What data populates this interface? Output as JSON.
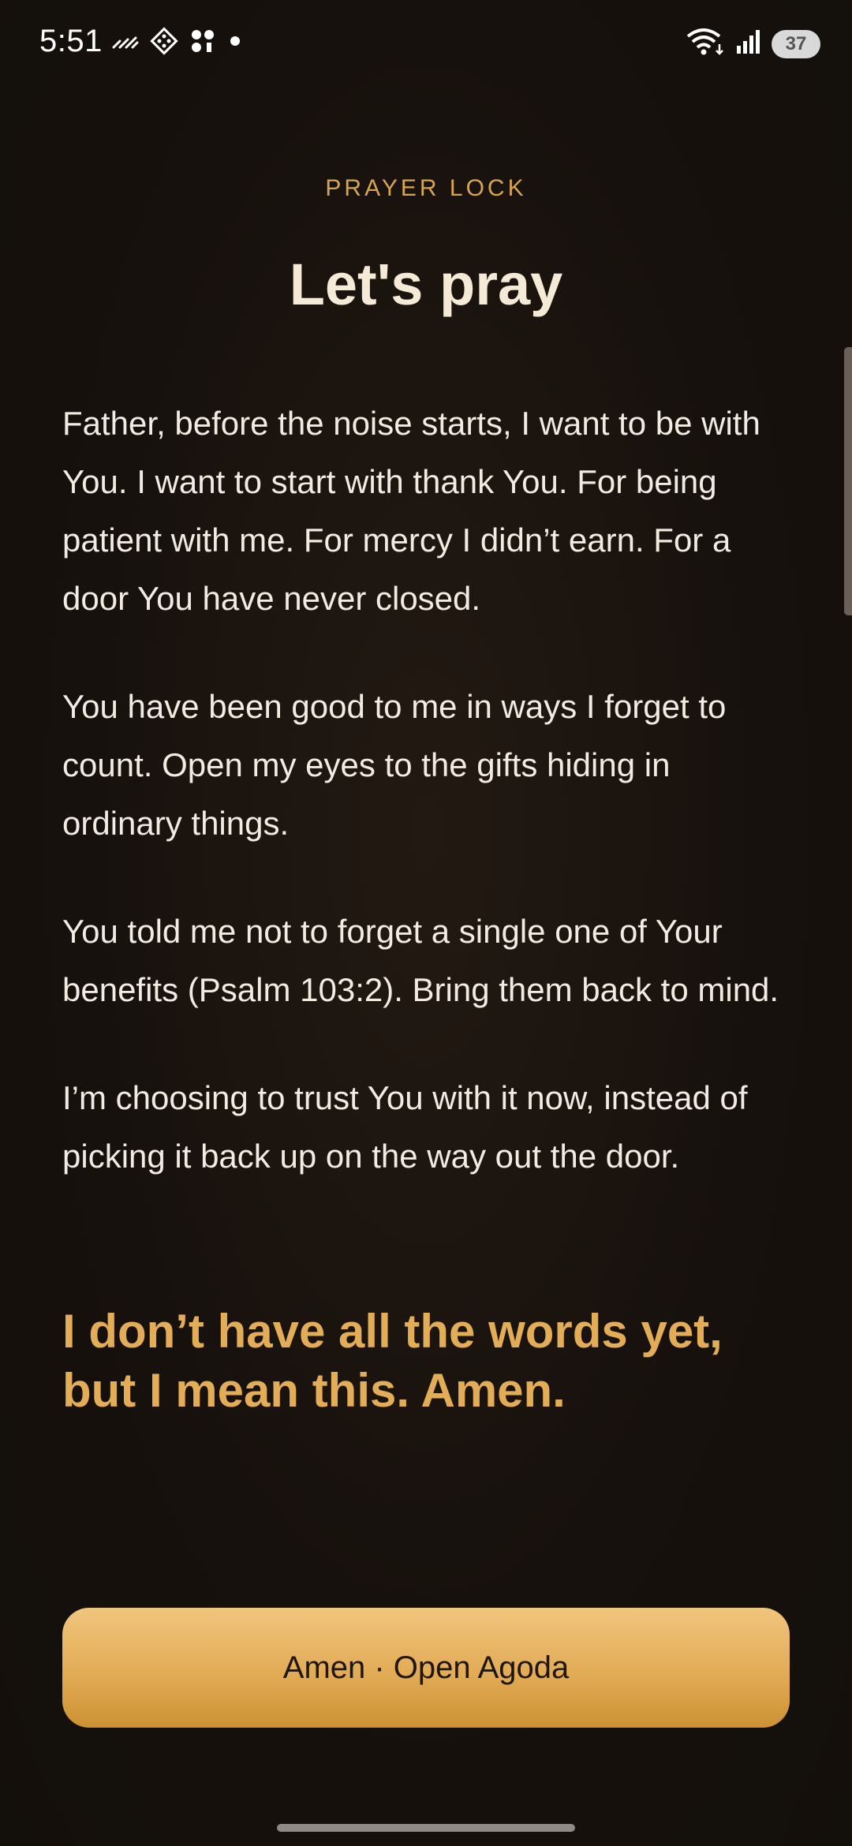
{
  "status_bar": {
    "time": "5:51",
    "battery": "37",
    "left_icons": [
      "signal-off-icon",
      "app-diamond-icon",
      "app-dots-icon",
      "notification-dot-icon"
    ],
    "right_icons": [
      "wifi-icon",
      "cellular-signal-icon",
      "battery-icon"
    ]
  },
  "header": {
    "eyebrow": "PRAYER LOCK",
    "title": "Let's pray"
  },
  "prayer": {
    "paragraphs": [
      "Father, before the noise starts, I want to be with You. I want to start with thank You. For being patient with me. For mercy I didn’t earn. For a door You have never closed.",
      "You have been good to me in ways I forget to count. Open my eyes to the gifts hiding in ordinary things.",
      "You told me not to forget a single one of Your benefits (Psalm 103:2). Bring them back to mind.",
      "I’m choosing to trust You with it now, instead of picking it back up on the way out the door."
    ],
    "closing": "I don’t have all the words yet, but I mean this. Amen."
  },
  "cta": {
    "label": "Amen · Open Agoda"
  },
  "colors": {
    "accent": "#e3ad58",
    "background": "#15100c",
    "text": "#f1ebe2"
  }
}
